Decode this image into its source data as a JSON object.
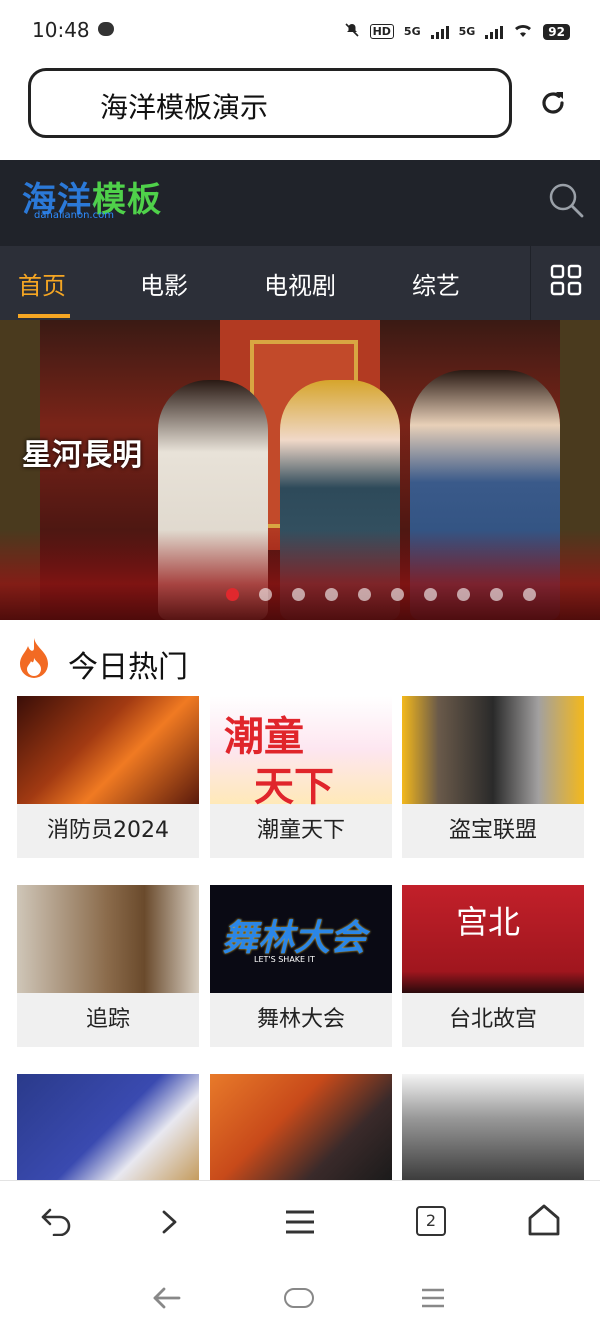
{
  "status_bar": {
    "time": "10:48",
    "battery": "92",
    "network_1": "5G",
    "network_2": "5G",
    "hd": "HD"
  },
  "browser": {
    "url_text": "海洋模板演示"
  },
  "site": {
    "logo_text": "海洋模板",
    "logo_sub": "danalianon.com"
  },
  "nav": {
    "items": [
      "首页",
      "电影",
      "电视剧",
      "综艺"
    ],
    "active_index": 0,
    "accent": "#f5a623"
  },
  "banner": {
    "title_text": "星河長明",
    "dot_count": 10,
    "active_dot": 0
  },
  "section": {
    "title": "今日热门"
  },
  "cards": [
    {
      "title": "消防员2024"
    },
    {
      "title": "潮童天下",
      "poster_text_1": "潮童",
      "poster_text_2": "天下"
    },
    {
      "title": "盗宝联盟"
    },
    {
      "title": "追踪"
    },
    {
      "title": "舞林大会",
      "poster_text": "舞林大会",
      "poster_sub": "LET'S SHAKE IT"
    },
    {
      "title": "台北故宫",
      "poster_text": "宫北"
    },
    {
      "title": ""
    },
    {
      "title": ""
    },
    {
      "title": ""
    }
  ],
  "toolbar": {
    "tabs_count": "2"
  }
}
